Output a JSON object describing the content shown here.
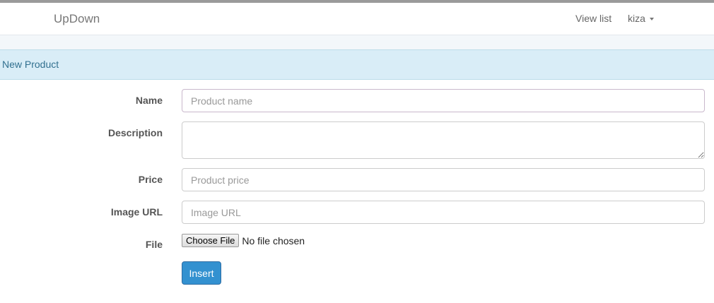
{
  "navbar": {
    "brand": "UpDown",
    "links": [
      {
        "label": "View list"
      },
      {
        "label": "kiza"
      }
    ]
  },
  "panel": {
    "title": "New Product"
  },
  "form": {
    "fields": {
      "name": {
        "label": "Name",
        "value": "",
        "placeholder": "Product name"
      },
      "description": {
        "label": "Description",
        "value": ""
      },
      "price": {
        "label": "Price",
        "value": "",
        "placeholder": "Product price"
      },
      "image_url": {
        "label": "Image URL",
        "value": "",
        "placeholder": "Image URL"
      },
      "file": {
        "label": "File",
        "button_label": "Choose File",
        "status": "No file chosen"
      }
    },
    "submit_label": "Insert"
  },
  "colors": {
    "panel_heading_bg": "#d9edf7",
    "panel_heading_text": "#31708f",
    "primary_button": "#3391d0"
  }
}
